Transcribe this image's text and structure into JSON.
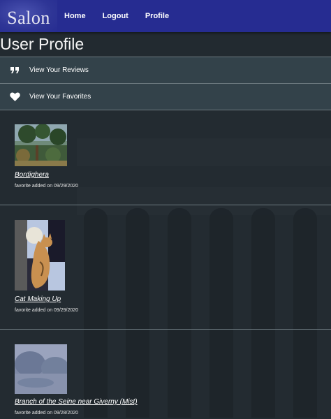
{
  "nav": {
    "brand": "Salon",
    "links": [
      "Home",
      "Logout",
      "Profile"
    ]
  },
  "page": {
    "title": "User Profile"
  },
  "accordions": {
    "reviews": {
      "label": "View Your Reviews",
      "icon": "quote-icon"
    },
    "favorites": {
      "label": "View Your Favorites",
      "icon": "heart-icon"
    }
  },
  "favorites": [
    {
      "title": "Bordighera",
      "added": "favorite added on 09/29/2020"
    },
    {
      "title": "Cat Making Up",
      "added": "favorite added on 09/29/2020"
    },
    {
      "title": "Branch of the Seine near Giverny (Mist)",
      "added": "favorite added on 09/28/2020"
    }
  ],
  "colors": {
    "navbar": "#262c91",
    "accordion": "#33424a",
    "page_bg": "#222a30"
  }
}
